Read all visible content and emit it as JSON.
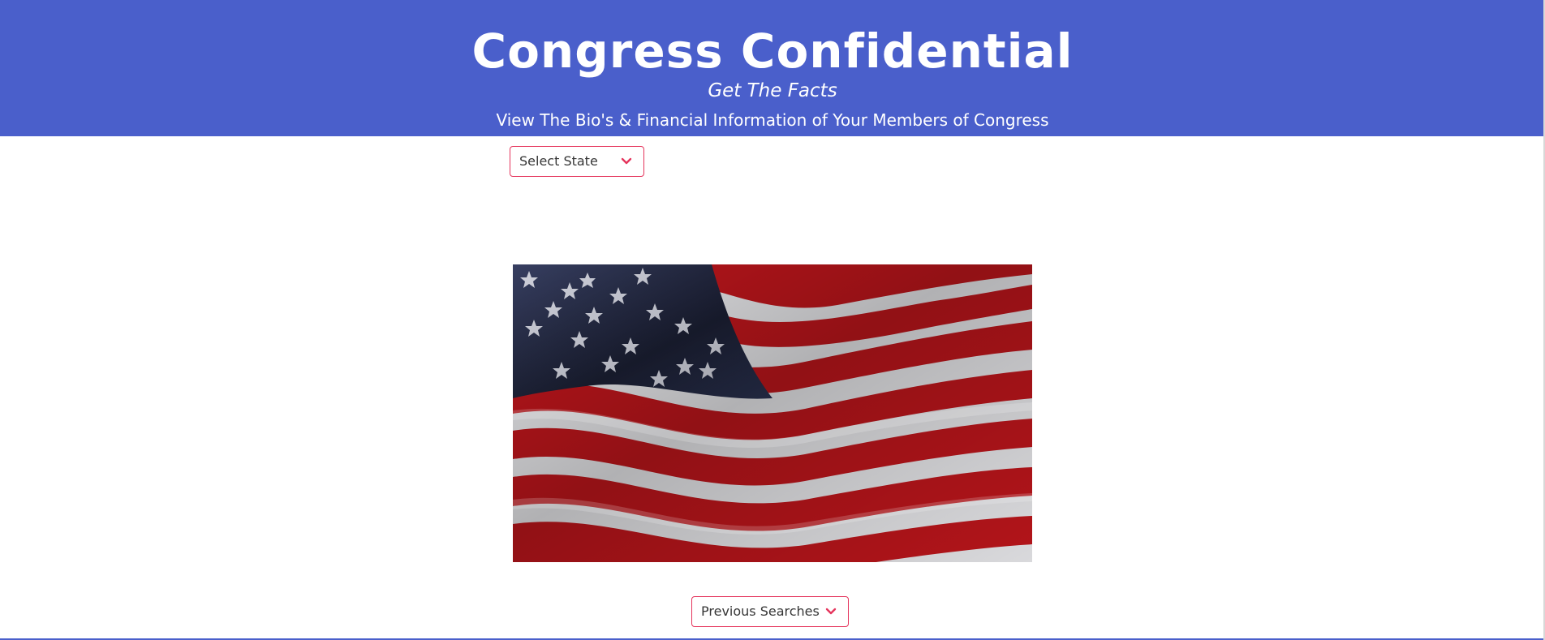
{
  "header": {
    "title": "Congress Confidential",
    "subtitle": "Get The Facts",
    "tagline": "View The Bio's & Financial Information of Your Members of Congress"
  },
  "state_select": {
    "selected": "Select State",
    "icon": "chevron-down-icon"
  },
  "previous_searches": {
    "selected": "Previous Searches",
    "icon": "chevron-down-icon"
  },
  "hero_image": {
    "subject": "american-flag-image"
  },
  "colors": {
    "header_bg": "#4a5fcb",
    "select_border": "#e5345c",
    "chevron": "#e5345c",
    "text_light": "#ffffff",
    "text_dark": "#363636"
  }
}
